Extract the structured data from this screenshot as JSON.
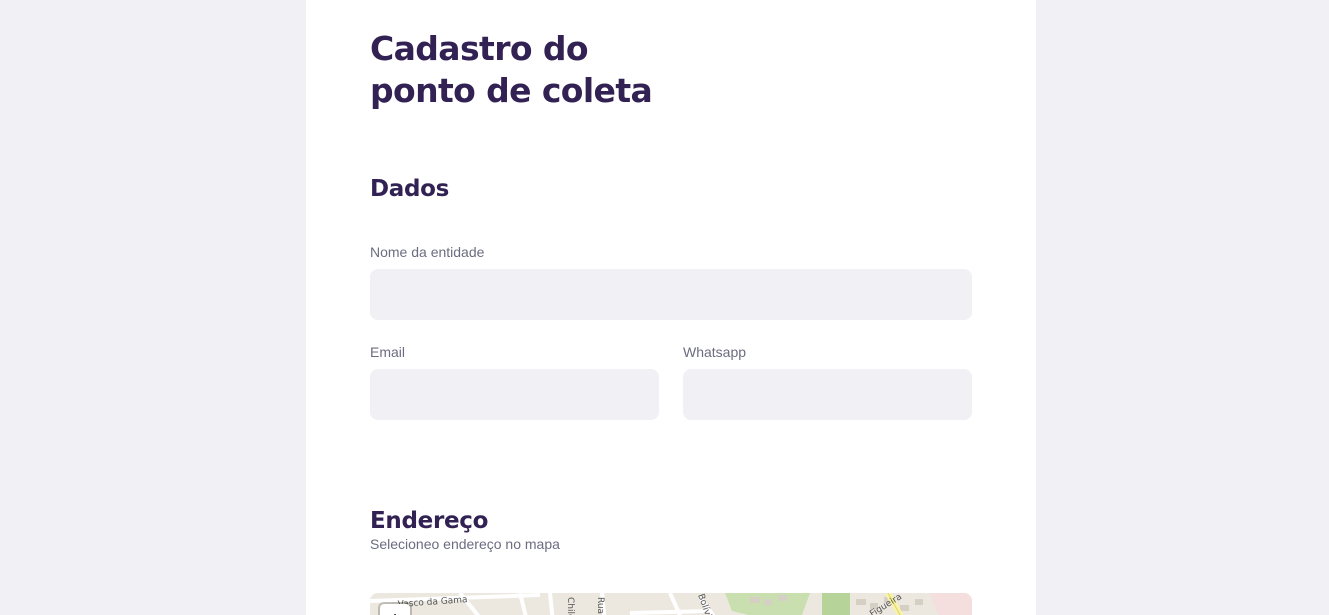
{
  "form": {
    "title": "Cadastro do ponto de coleta"
  },
  "dados": {
    "heading": "Dados",
    "nome": {
      "label": "Nome da entidade",
      "value": ""
    },
    "email": {
      "label": "Email",
      "value": ""
    },
    "whatsapp": {
      "label": "Whatsapp",
      "value": ""
    }
  },
  "endereco": {
    "heading": "Endereço",
    "hint": "Selecioneo endereço no mapa",
    "map": {
      "street_labels": [
        "Vasco da Gama",
        "Chile",
        "Rua S",
        "Bolívia",
        "Figueira"
      ],
      "zoom_in_label": "+"
    }
  },
  "colors": {
    "heading": "#322153",
    "label": "#6c6c80",
    "input_bg": "#f0f0f5",
    "card_bg": "#ffffff",
    "page_bg": "#f0f0f5"
  }
}
